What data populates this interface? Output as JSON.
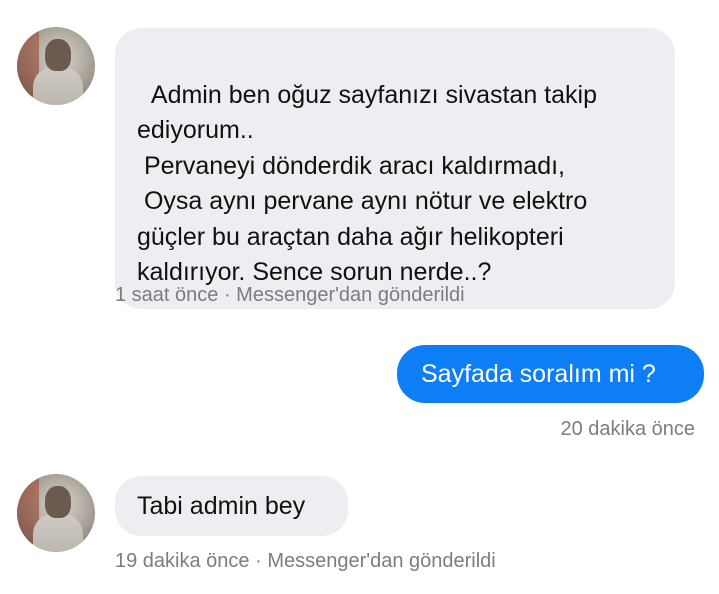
{
  "conversation": {
    "messages": [
      {
        "direction": "incoming",
        "text": "Admin ben oğuz sayfanızı sivastan takip ediyorum..\n Pervaneyi dönderdik aracı kaldırmadı,\n Oysa aynı pervane aynı nötur ve elektro güçler bu araçtan daha ağır helikopteri kaldırıyor. Sence sorun nerde..?",
        "meta": "1 saat önce · Messenger'dan gönderildi"
      },
      {
        "direction": "outgoing",
        "text": "Sayfada soralım mi ?",
        "meta": "20 dakika önce"
      },
      {
        "direction": "incoming",
        "text": "Tabi admin bey",
        "meta": "19 dakika önce · Messenger'dan gönderildi"
      }
    ]
  },
  "colors": {
    "incoming_bubble": "#eceef1",
    "outgoing_bubble": "#0d7ef5",
    "meta_text": "#7a7d82"
  }
}
